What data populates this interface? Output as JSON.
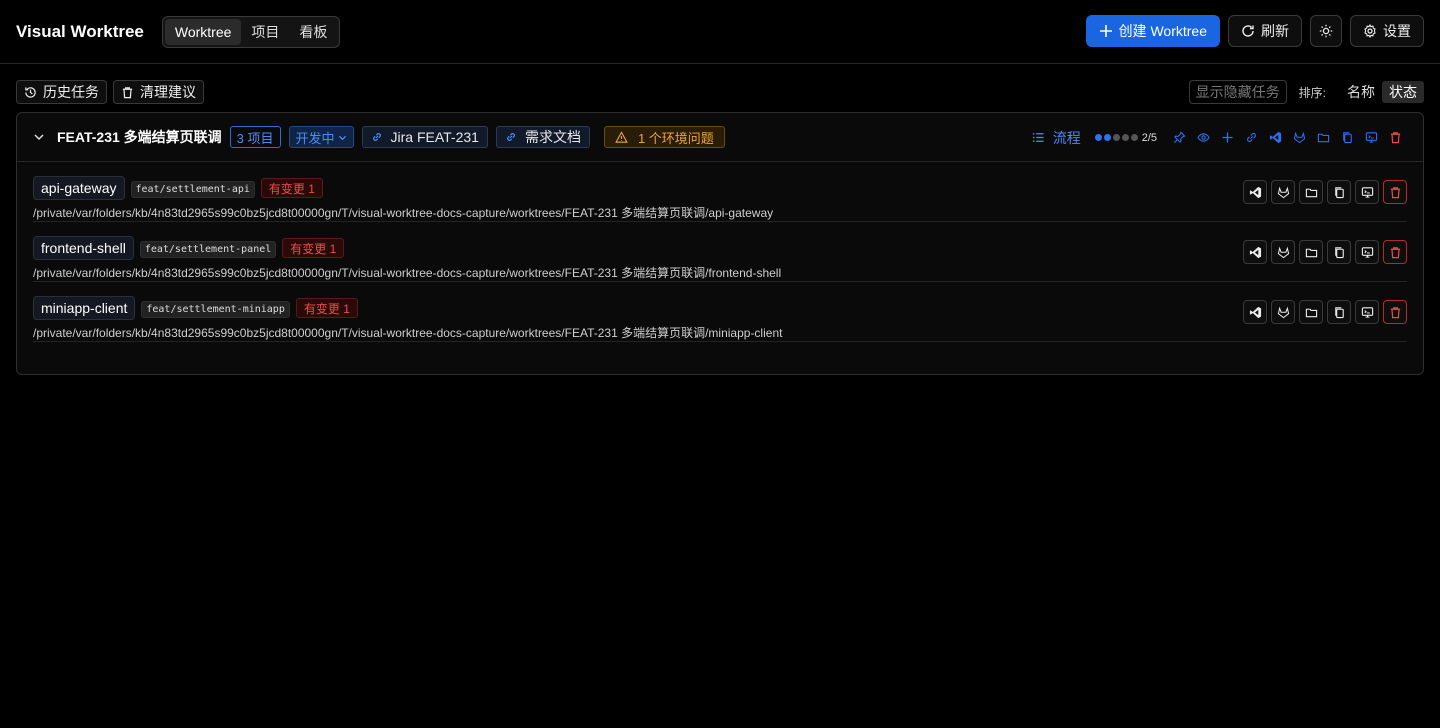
{
  "header": {
    "app_title": "Visual Worktree",
    "tabs": [
      {
        "label": "Worktree",
        "active": true
      },
      {
        "label": "项目",
        "active": false
      },
      {
        "label": "看板",
        "active": false
      }
    ],
    "create_label": "创建 Worktree",
    "refresh_label": "刷新",
    "settings_label": "设置"
  },
  "toolbar": {
    "history_label": "历史任务",
    "cleanup_label": "清理建议",
    "show_hidden_label": "显示隐藏任务",
    "sort_label": "排序:",
    "sort_options": [
      {
        "label": "名称",
        "active": false
      },
      {
        "label": "状态",
        "active": true
      }
    ]
  },
  "task": {
    "title": "FEAT-231 多端结算页联调",
    "project_count": "3 项目",
    "status": "开发中",
    "links": [
      {
        "label": "Jira FEAT-231"
      },
      {
        "label": "需求文档"
      }
    ],
    "env_issue": "1 个环境问题",
    "flow_label": "流程",
    "progress": {
      "done": 2,
      "total": 5,
      "text": "2/5"
    },
    "worktrees": [
      {
        "repo": "api-gateway",
        "branch": "feat/settlement-api",
        "changes": "有变更 1",
        "path": "/private/var/folders/kb/4n83td2965s99c0bz5jcd8t00000gn/T/visual-worktree-docs-capture/worktrees/FEAT-231 多端结算页联调/api-gateway"
      },
      {
        "repo": "frontend-shell",
        "branch": "feat/settlement-panel",
        "changes": "有变更 1",
        "path": "/private/var/folders/kb/4n83td2965s99c0bz5jcd8t00000gn/T/visual-worktree-docs-capture/worktrees/FEAT-231 多端结算页联调/frontend-shell"
      },
      {
        "repo": "miniapp-client",
        "branch": "feat/settlement-miniapp",
        "changes": "有变更 1",
        "path": "/private/var/folders/kb/4n83td2965s99c0bz5jcd8t00000gn/T/visual-worktree-docs-capture/worktrees/FEAT-231 多端结算页联调/miniapp-client"
      }
    ]
  },
  "colors": {
    "accent": "#1a66e0",
    "link": "#4a8cf7",
    "warning": "#f0a43a",
    "danger": "#f04b4b"
  },
  "icons": {
    "row_actions": [
      "vscode-icon",
      "gitlab-icon",
      "folder-icon",
      "copy-icon",
      "terminal-icon",
      "trash-icon"
    ]
  }
}
